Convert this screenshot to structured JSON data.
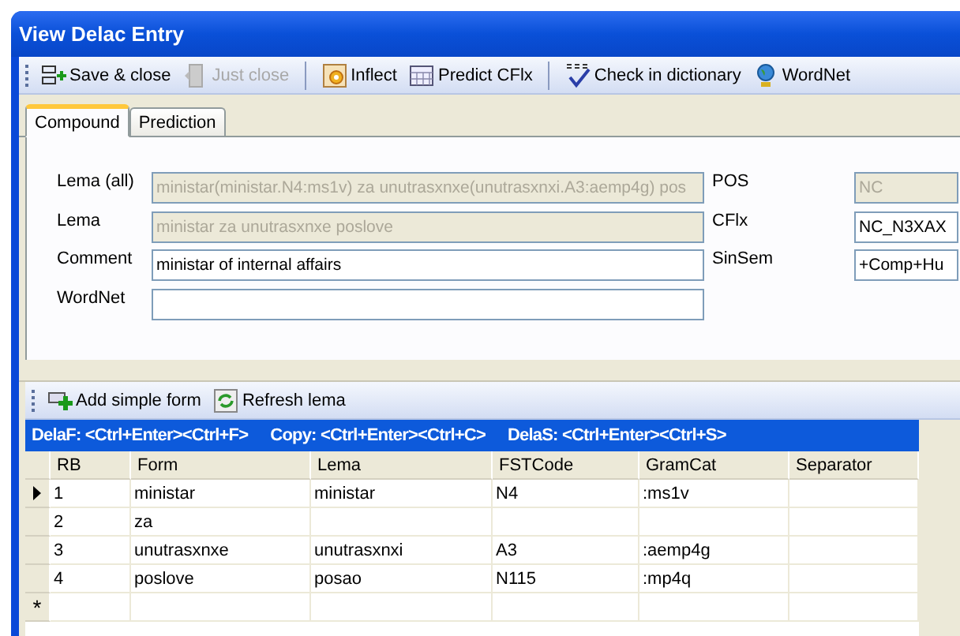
{
  "window": {
    "title": "View Delac Entry"
  },
  "toolbar": [
    [
      {
        "label": "Save & close",
        "disabled": false
      },
      {
        "label": "Just close",
        "disabled": true
      }
    ],
    [
      {
        "label": "Inflect",
        "disabled": false
      },
      {
        "label": "Predict CFlx",
        "disabled": false
      }
    ],
    [
      {
        "label": "Check in dictionary",
        "disabled": false
      },
      {
        "label": "WordNet",
        "disabled": false
      }
    ]
  ],
  "tabs": [
    {
      "label": "Compound",
      "selected": true
    },
    {
      "label": "Prediction",
      "selected": false
    }
  ],
  "fields_left": [
    {
      "label": "Lema (all)",
      "value": "ministar(ministar.N4:ms1v) za unutrasxnxe(unutrasxnxi.A3:aemp4g) pos",
      "disabled": true
    },
    {
      "label": "Lema",
      "value": "ministar za unutrasxnxe poslove",
      "disabled": true
    },
    {
      "label": "Comment",
      "value": "ministar of internal affairs",
      "disabled": false
    },
    {
      "label": "WordNet",
      "disabled": false
    }
  ],
  "fields_right": [
    {
      "label": "POS",
      "value": "NC",
      "disabled": true
    },
    {
      "label": "CFlx",
      "value": "NC_N3XAX",
      "disabled": false
    },
    {
      "label": "SinSem",
      "value": "+Comp+Hu",
      "disabled": false
    }
  ],
  "grid_toolbar": [
    {
      "label": "Add simple form"
    },
    {
      "label": "Refresh lema"
    }
  ],
  "shortcuts": [
    "DelaF: <Ctrl+Enter><Ctrl+F>",
    "Copy: <Ctrl+Enter><Ctrl+C>",
    "DelaS: <Ctrl+Enter><Ctrl+S>"
  ],
  "table": {
    "columns": [
      "RB",
      "Form",
      "Lema",
      "FSTCode",
      "GramCat",
      "Separator"
    ],
    "rows": [
      {
        "cells": [
          "1",
          "ministar",
          "ministar",
          "N4",
          ":ms1v",
          ""
        ],
        "selected": true
      },
      {
        "cells": [
          "2",
          "za",
          "",
          "",
          "",
          ""
        ],
        "selected": false
      },
      {
        "cells": [
          "3",
          "unutrasxnxe",
          "unutrasxnxi",
          "A3",
          ":aemp4g",
          ""
        ],
        "selected": false
      },
      {
        "cells": [
          "4",
          "poslove",
          "posao",
          "N115",
          ":mp4q",
          ""
        ],
        "selected": false
      }
    ],
    "new_row_marker": "*"
  }
}
